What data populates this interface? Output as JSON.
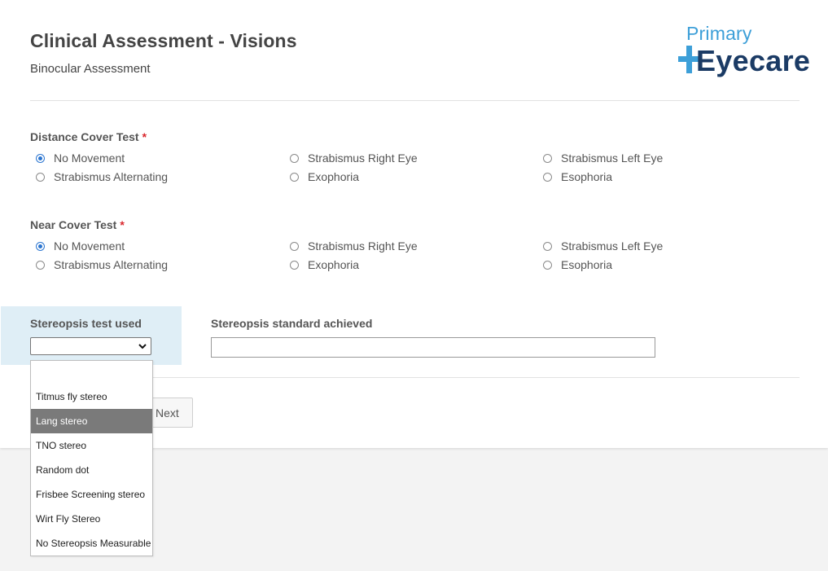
{
  "header": {
    "title": "Clinical Assessment - Visions",
    "subtitle": "Binocular Assessment",
    "logo_top": "Primary",
    "logo_bottom": "Eyecare"
  },
  "required_marker": "*",
  "distance_cover_test": {
    "label": "Distance Cover Test",
    "options": [
      "No Movement",
      "Strabismus Right Eye",
      "Strabismus Left Eye",
      "Strabismus Alternating",
      "Exophoria",
      "Esophoria"
    ],
    "selected": "No Movement"
  },
  "near_cover_test": {
    "label": "Near Cover Test",
    "options": [
      "No Movement",
      "Strabismus Right Eye",
      "Strabismus Left Eye",
      "Strabismus Alternating",
      "Exophoria",
      "Esophoria"
    ],
    "selected": "No Movement"
  },
  "stereopsis": {
    "test_label": "Stereopsis test used",
    "selected_value": "",
    "options": [
      "",
      "Titmus fly stereo",
      "Lang stereo",
      "TNO stereo",
      "Random dot",
      "Frisbee Screening stereo",
      "Wirt Fly Stereo",
      "No Stereopsis Measurable"
    ],
    "highlighted": "Lang stereo",
    "standard_label": "Stereopsis standard achieved",
    "standard_value": ""
  },
  "buttons": {
    "next": "Next"
  },
  "colors": {
    "accent_blue": "#2b75d0",
    "logo_light": "#3d9fd8",
    "logo_dark": "#1b3b65",
    "required_red": "#d9262c",
    "panel_highlight": "#dfeef6",
    "dropdown_selected": "#7a7a7a"
  },
  "icons": {
    "select_arrow": "chevron-down-icon"
  }
}
